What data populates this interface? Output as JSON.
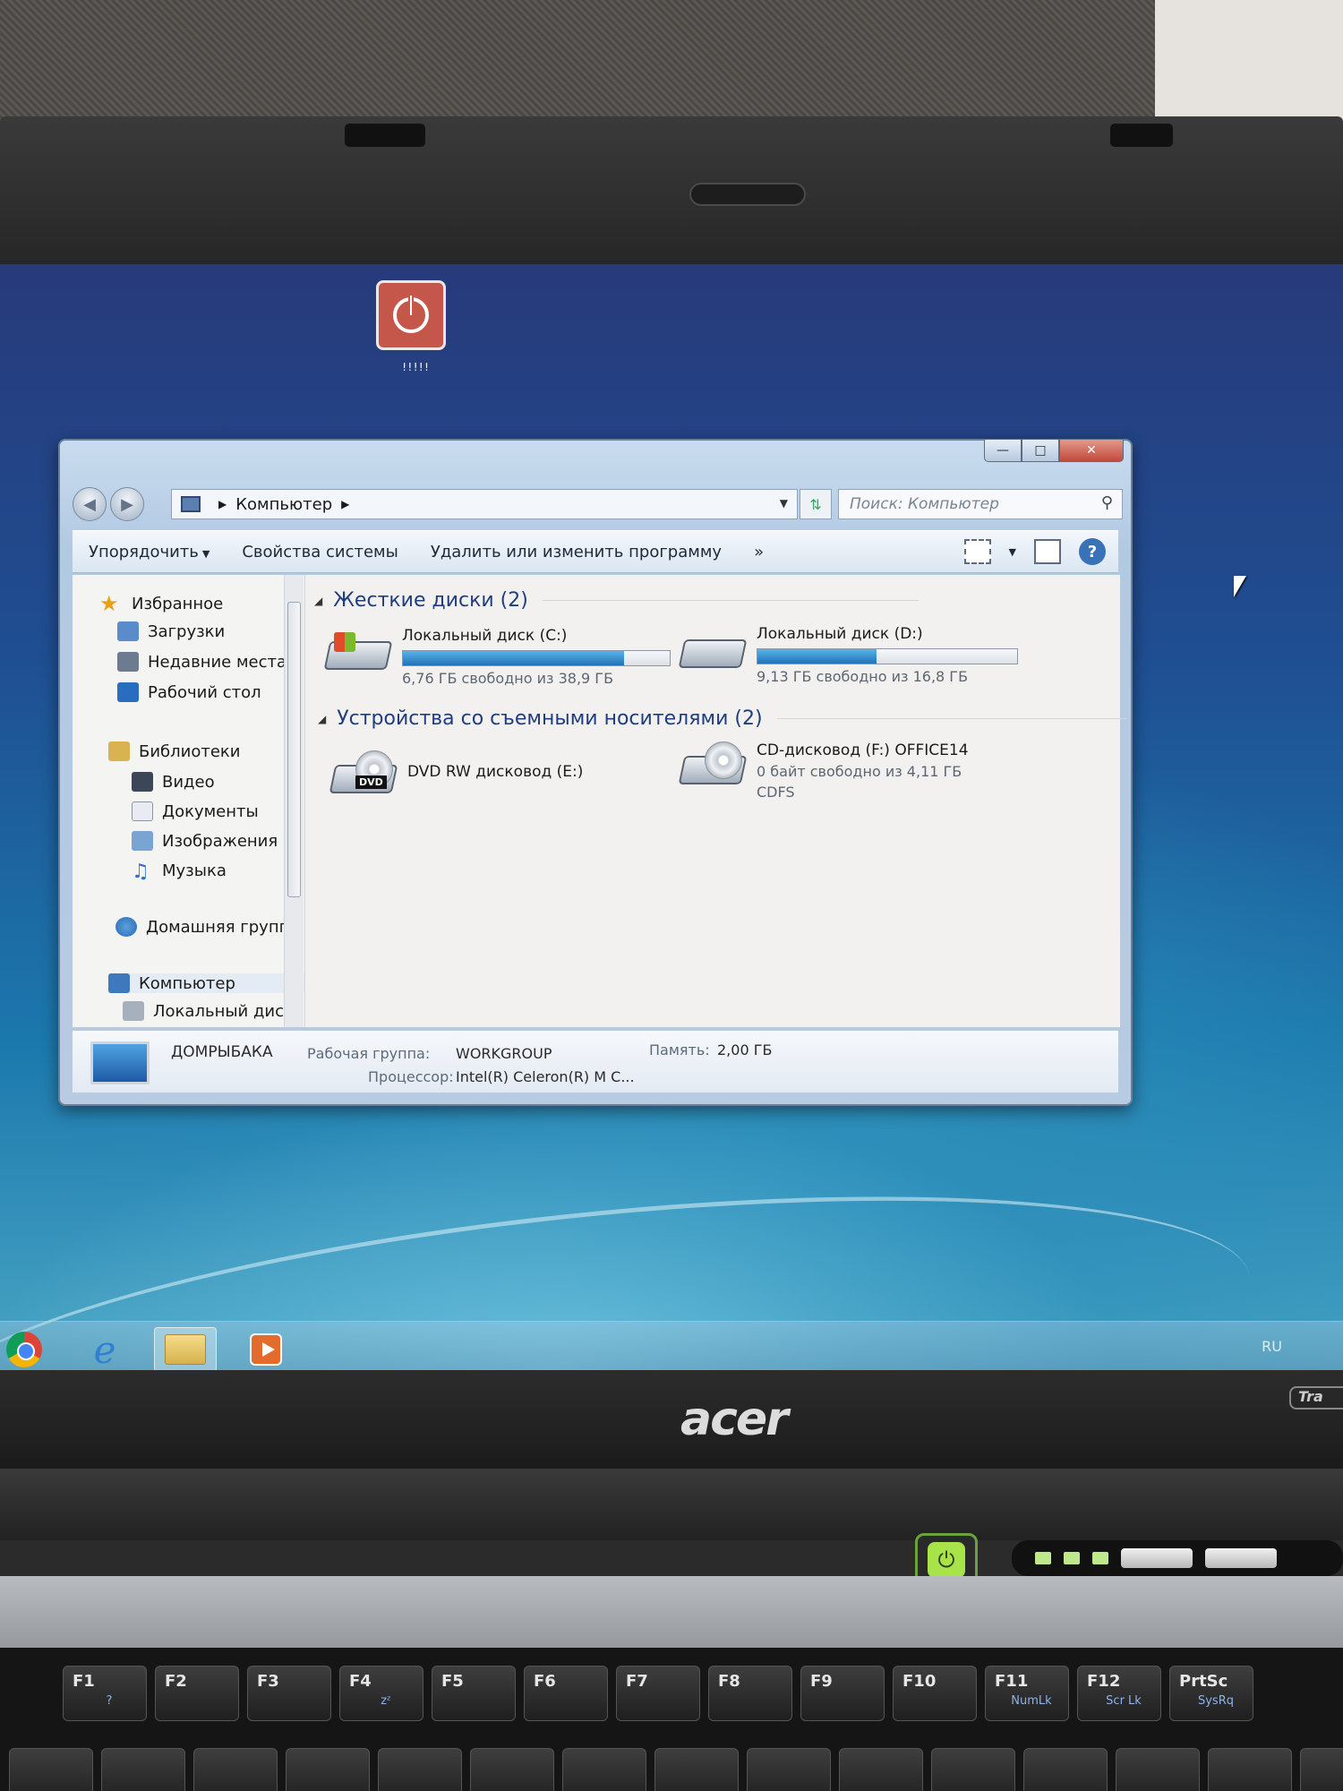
{
  "explorer": {
    "address": {
      "location": "Компьютер"
    },
    "search": {
      "placeholder": "Поиск: Компьютер"
    },
    "toolbar": {
      "organize": "Упорядочить",
      "system_properties": "Свойства системы",
      "uninstall": "Удалить или изменить программу",
      "more": "»"
    },
    "nav_pane": {
      "favorites": "Избранное",
      "downloads": "Загрузки",
      "recent": "Недавние места",
      "desktop": "Рабочий стол",
      "libraries": "Библиотеки",
      "video": "Видео",
      "documents": "Документы",
      "pictures": "Изображения",
      "music": "Музыка",
      "homegroup": "Домашняя группа",
      "computer": "Компьютер",
      "local_disk": "Локальный диск"
    },
    "groups": {
      "hard_drives": "Жесткие диски (2)",
      "removable": "Устройства со съемными носителями (2)"
    },
    "drives": {
      "c": {
        "name": "Локальный диск (C:)",
        "free_text": "6,76 ГБ свободно из 38,9 ГБ",
        "used_fraction": 0.83
      },
      "d": {
        "name": "Локальный диск (D:)",
        "free_text": "9,13 ГБ свободно из 16,8 ГБ",
        "used_fraction": 0.46
      },
      "e": {
        "name": "DVD RW дисковод (E:)",
        "icon_tag": "DVD"
      },
      "f": {
        "name": "CD-дисковод (F:) OFFICE14",
        "free_text": "0 байт свободно из 4,11 ГБ",
        "fs": "CDFS"
      }
    },
    "details": {
      "computer_name": "ДОМРЫБАКА",
      "workgroup_label": "Рабочая группа:",
      "workgroup_value": "WORKGROUP",
      "memory_label": "Память:",
      "memory_value": "2,00 ГБ",
      "cpu_label": "Процессор:",
      "cpu_value": "Intel(R) Celeron(R) M C..."
    }
  },
  "taskbar": {
    "language": "RU"
  },
  "hardware": {
    "brand": "acer",
    "model_badge": "Tra",
    "keys": [
      {
        "main": "F1",
        "sub": "?"
      },
      {
        "main": "F2",
        "sub": ""
      },
      {
        "main": "F3",
        "sub": ""
      },
      {
        "main": "F4",
        "sub": "zᶻ"
      },
      {
        "main": "F5",
        "sub": ""
      },
      {
        "main": "F6",
        "sub": ""
      },
      {
        "main": "F7",
        "sub": ""
      },
      {
        "main": "F8",
        "sub": ""
      },
      {
        "main": "F9",
        "sub": ""
      },
      {
        "main": "F10",
        "sub": ""
      },
      {
        "main": "F11",
        "sub": "NumLk"
      },
      {
        "main": "F12",
        "sub": "Scr Lk"
      },
      {
        "main": "PrtSc",
        "sub": "SysRq"
      }
    ]
  },
  "colors": {
    "accent": "#1e3e80",
    "bar_fill": "#1f72b8",
    "power_led": "#a9e34a"
  }
}
